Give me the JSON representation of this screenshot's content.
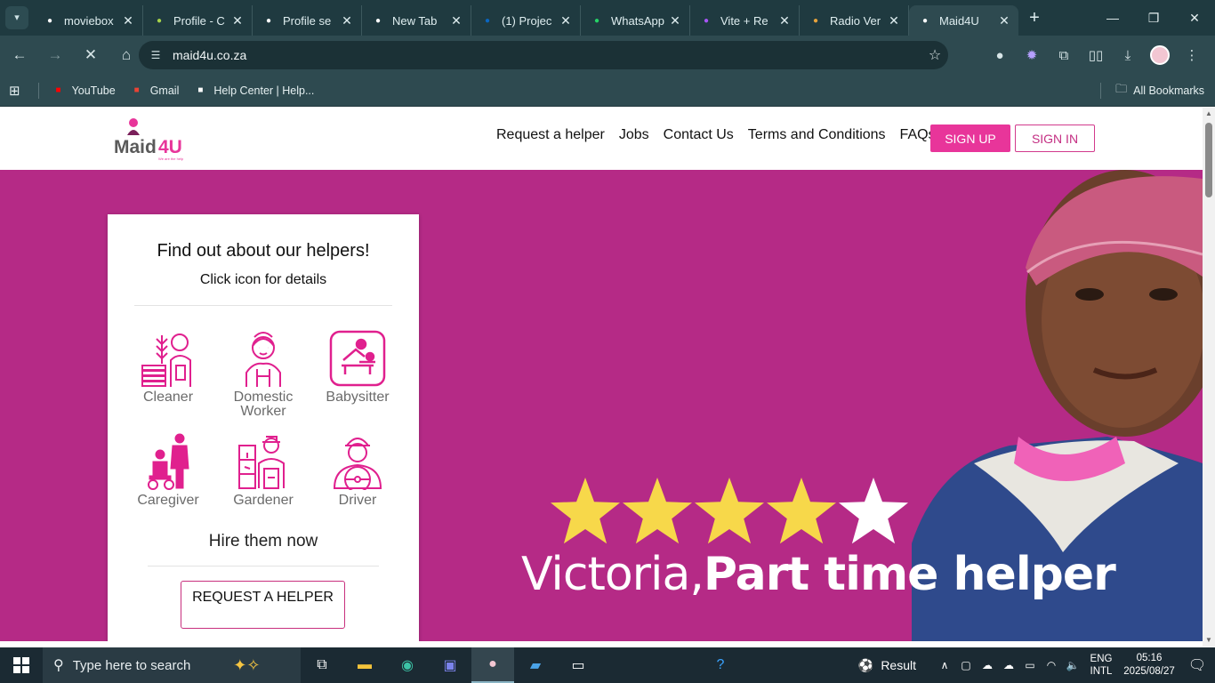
{
  "browser": {
    "tabs": [
      {
        "title": "moviebox",
        "icon": "globe-icon",
        "color": "#ffffff"
      },
      {
        "title": "Profile - C",
        "icon": "pencil-icon",
        "color": "#a6d34a"
      },
      {
        "title": "Profile se",
        "icon": "openai-icon",
        "color": "#ffffff"
      },
      {
        "title": "New Tab",
        "icon": "chrome-icon",
        "color": "#ffffff"
      },
      {
        "title": "(1) Projec",
        "icon": "linkedin-icon",
        "color": "#0a66c2"
      },
      {
        "title": "WhatsApp",
        "icon": "whatsapp-icon",
        "color": "#25d366"
      },
      {
        "title": "Vite + Re",
        "icon": "vite-icon",
        "color": "#a855f7"
      },
      {
        "title": "Radio Ver",
        "icon": "radio-icon",
        "color": "#e6a23c"
      },
      {
        "title": "Maid4U",
        "icon": "maid4u-icon",
        "color": "#ffffff",
        "active": true
      }
    ],
    "url": "maid4u.co.za",
    "bookmarks": [
      {
        "label": "YouTube",
        "icon": "youtube-icon",
        "color": "#ff0000"
      },
      {
        "label": "Gmail",
        "icon": "gmail-icon",
        "color": "#ea4335"
      },
      {
        "label": "Help Center | Help...",
        "icon": "globe-icon",
        "color": "#ffffff"
      }
    ],
    "all_bookmarks": "All Bookmarks"
  },
  "site": {
    "brand_tagline": "We are the help",
    "nav": [
      "Request a helper",
      "Jobs",
      "Contact Us",
      "Terms and Conditions",
      "FAQs"
    ],
    "signup_label": "SIGN UP",
    "signin_label": "SIGN IN",
    "accent": "#e8359a",
    "hero_bg": "#b52a86"
  },
  "card": {
    "title": "Find out about our helpers!",
    "subtitle": "Click icon for details",
    "helpers": [
      {
        "label": "Cleaner",
        "icon": "cleaner-icon"
      },
      {
        "label": "Domestic Worker",
        "icon": "domestic-worker-icon"
      },
      {
        "label": "Babysitter",
        "icon": "babysitter-icon"
      },
      {
        "label": "Caregiver",
        "icon": "caregiver-icon"
      },
      {
        "label": "Gardener",
        "icon": "gardener-icon"
      },
      {
        "label": "Driver",
        "icon": "driver-icon"
      }
    ],
    "hire_text": "Hire them now",
    "request_button": "REQUEST A HELPER"
  },
  "hero": {
    "rating": 4,
    "rating_max": 5,
    "caption_name": "Victoria,",
    "caption_role": "Part time helper"
  },
  "taskbar": {
    "search_placeholder": "Type here to search",
    "weather": "Result",
    "lang_line1": "ENG",
    "lang_line2": "INTL",
    "time": "05:16",
    "date": "2025/08/27"
  }
}
